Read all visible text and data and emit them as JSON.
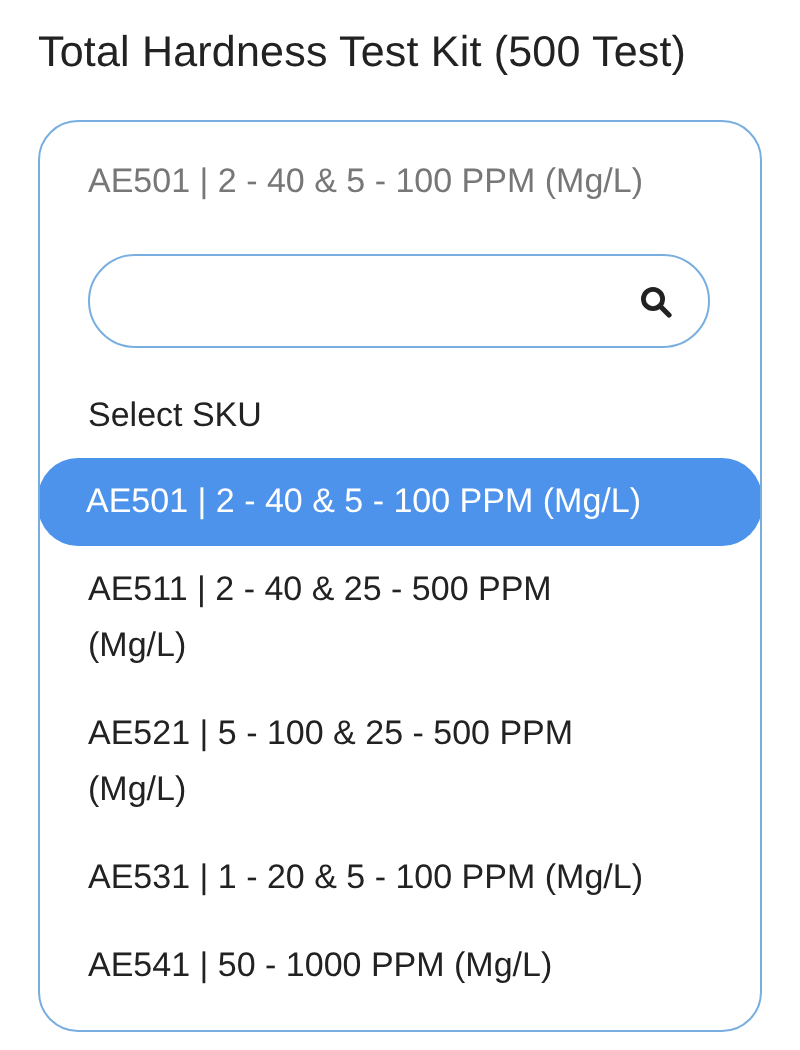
{
  "title": "Total Hardness Test Kit (500 Test)",
  "sku_select": {
    "value": "AE501 | 2 - 40 & 5 - 100 PPM (Mg/L)",
    "expanded": true,
    "options": [
      {
        "label": "Select SKU",
        "selected": false
      },
      {
        "label": "AE501 | 2 - 40 & 5 - 100 PPM (Mg/L)",
        "selected": true
      },
      {
        "label": "AE511 | 2 - 40 & 25 - 500 PPM (Mg/L)",
        "selected": false
      },
      {
        "label": "AE521 | 5 - 100 & 25 - 500 PPM (Mg/L)",
        "selected": false
      },
      {
        "label": "AE531 | 1 - 20 & 5 - 100 PPM (Mg/L)",
        "selected": false
      },
      {
        "label": "AE541 | 50 - 1000 PPM (Mg/L)",
        "selected": false
      }
    ]
  }
}
